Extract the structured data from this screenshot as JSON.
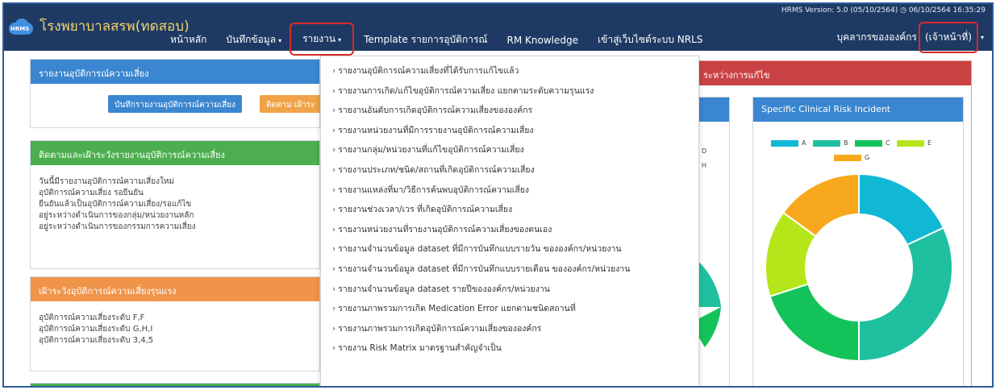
{
  "navbar": {
    "version": "HRMS Version: 5.0 (05/10/2564) ◷ 06/10/2564 16:35:29",
    "logo_text": "HRMS",
    "brand": "โรงพยาบาลสรพ(ทดสอบ)",
    "menu": [
      {
        "label": "หน้าหลัก"
      },
      {
        "label": "บันทึกข้อมูล",
        "caret": "▾"
      },
      {
        "label": "รายงาน",
        "caret": "▾"
      },
      {
        "label": "Template รายการอุบัติการณ์"
      },
      {
        "label": "RM Knowledge"
      },
      {
        "label": "เข้าสู่เว็บไซต์ระบบ NRLS"
      }
    ],
    "user_label": "บุคลากรขององค์กร",
    "user_role": "(เจ้าหน้าที่)",
    "user_caret": "▾"
  },
  "panels": {
    "report_incident": {
      "title": "รายงานอุบัติการณ์ความเสี่ยง",
      "btn_save": "บันทึกรายงานอุบัติการณ์ความเสี่ยง",
      "btn_track": "ติดตาม เฝ้าระ"
    },
    "follow_up": {
      "title": "ติดตามและเฝ้าระวังรายงานอุบัติการณ์ความเสี่ยง",
      "items": [
        "วันนี้มีรายงานอุบัติการณ์ความเสี่ยงใหม่",
        "อุบัติการณ์ความเสี่ยง รอยืนยัน",
        "ยืนยันแล้วเป็นอุบัติการณ์ความเสี่ยง/รอแก้ไข",
        "อยู่ระหว่างดำเนินการของกลุ่ม/หน่วยงานหลัก",
        "อยู่ระหว่างดำเนินการของกรรมการความเสี่ยง"
      ]
    },
    "severe": {
      "title": "เฝ้าระวังอุบัติการณ์ความเสี่ยงรุนแรง",
      "items": [
        "อุบัติการณ์ความเสี่ยงระดับ F,F",
        "อุบัติการณ์ความเสี่ยงระดับ G,H,I",
        "อุบัติการณ์ความเสี่ยงระดับ 3,4,5"
      ]
    },
    "in_progress": {
      "title": "ระหว่างการแก้ไข"
    },
    "middle_chart": {
      "title_fragment": "n",
      "legend_letters": [
        "D",
        "H"
      ]
    },
    "clinical": {
      "title": "Specific Clinical Risk Incident"
    }
  },
  "dropdown": {
    "arrow": "›",
    "items": [
      "รายงานอุบัติการณ์ความเสี่ยงที่ได้รับการแก้ไขแล้ว",
      "รายงานการเกิด/แก้ไขอุบัติการณ์ความเสี่ยง แยกตามระดับความรุนแรง",
      "รายงานอันดับการเกิดอุบัติการณ์ความเสี่ยงขององค์กร",
      "รายงานหน่วยงานที่มีการรายงานอุบัติการณ์ความเสี่ยง",
      "รายงานกลุ่ม/หน่วยงานที่แก้ไขอุบัติการณ์ความเสี่ยง",
      "รายงานประเภท/ชนิด/สถานที่เกิดอุบัติการณ์ความเสี่ยง",
      "รายงานแหล่งที่มา/วิธีการค้นพบอุบัติการณ์ความเสี่ยง",
      "รายงานช่วงเวลา/เวร ที่เกิดอุบัติการณ์ความเสี่ยง",
      "รายงานหน่วยงานที่รายงานอุบัติการณ์ความเสี่ยงของตนเอง",
      "รายงานจำนวนข้อมูล dataset ที่มีการบันทึกแบบรายวัน ขององค์กร/หน่วยงาน",
      "รายงานจำนวนข้อมูล dataset ที่มีการบันทึกแบบรายเดือน ขององค์กร/หน่วยงาน",
      "รายงานจำนวนข้อมูล dataset รายปีขององค์กร/หน่วยงาน",
      "รายงานภาพรวมการเกิด Medication Error แยกตามชนิดสถานที่",
      "รายงานภาพรวมการเกิดอุบัติการณ์ความเสี่ยงขององค์กร",
      "รายงาน Risk Matrix มาตรฐานสำคัญจำเป็น"
    ]
  },
  "chart_data": {
    "type": "pie",
    "title": "Specific Clinical Risk Incident",
    "categories": [
      "A",
      "B",
      "C",
      "E",
      "G"
    ],
    "values": [
      18,
      32,
      20,
      15,
      15
    ],
    "colors": [
      "#10b8d4",
      "#1ec0a0",
      "#13c35a",
      "#b5e61a",
      "#f7a81c"
    ],
    "donut": true
  }
}
